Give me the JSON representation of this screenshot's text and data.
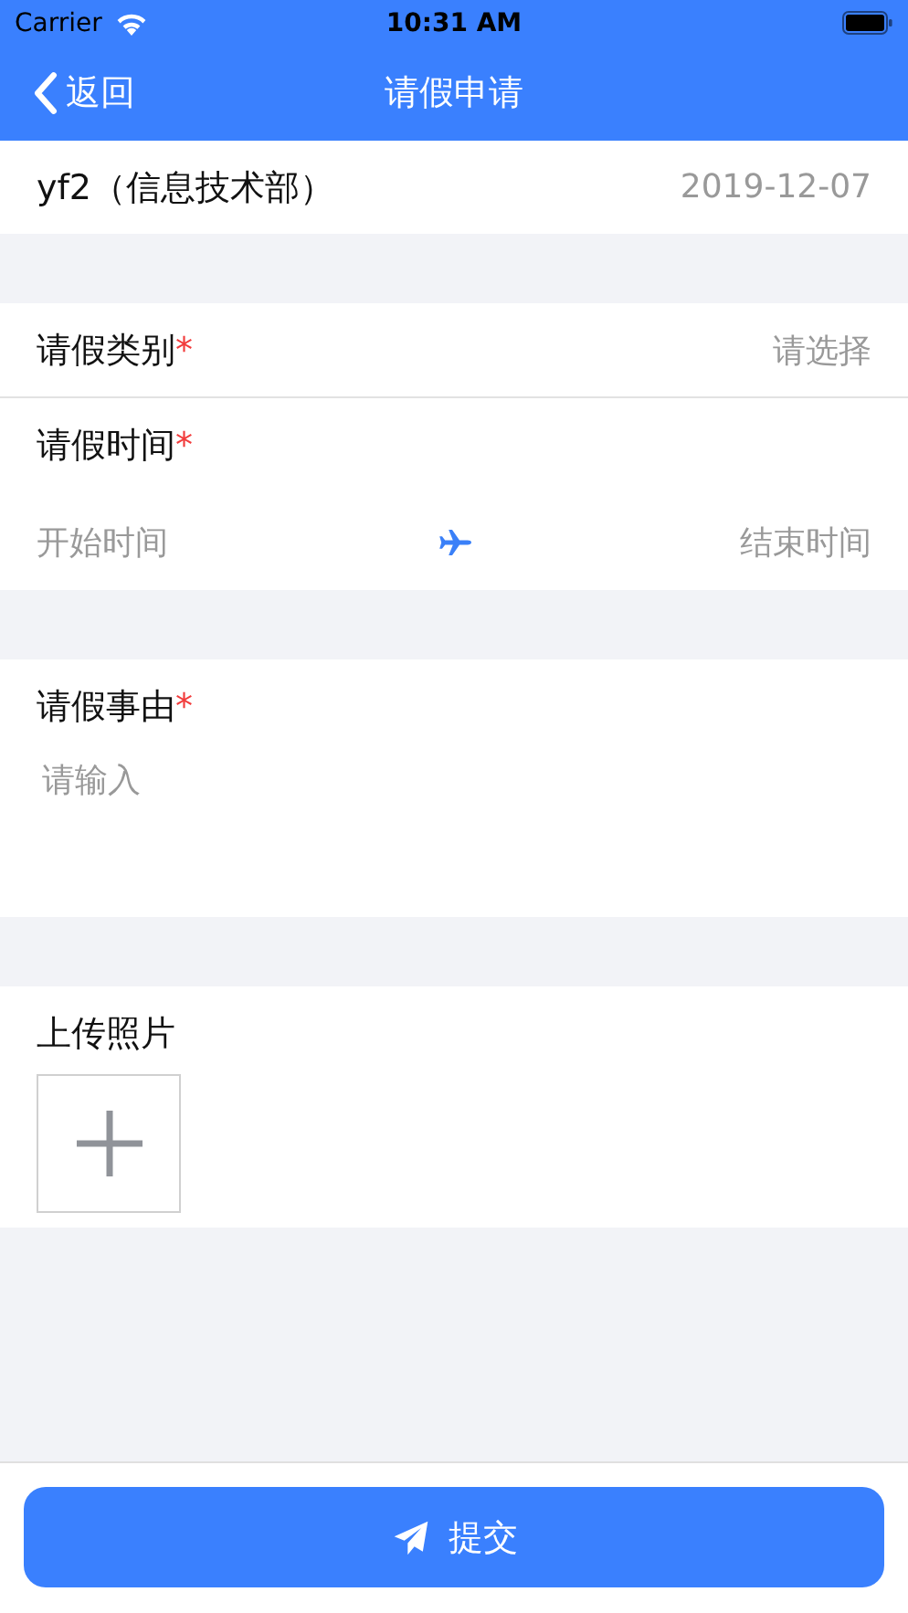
{
  "status_bar": {
    "carrier": "Carrier",
    "time": "10:31 AM"
  },
  "nav": {
    "back_label": "返回",
    "title": "请假申请"
  },
  "header": {
    "user": "yf2（信息技术部）",
    "date": "2019-12-07"
  },
  "leave_type": {
    "label": "请假类别",
    "required_mark": "*",
    "placeholder": "请选择"
  },
  "leave_time": {
    "label": "请假时间",
    "required_mark": "*",
    "start_placeholder": "开始时间",
    "end_placeholder": "结束时间"
  },
  "reason": {
    "label": "请假事由",
    "required_mark": "*",
    "placeholder": "请输入"
  },
  "photos": {
    "label": "上传照片"
  },
  "submit": {
    "label": "提交"
  }
}
